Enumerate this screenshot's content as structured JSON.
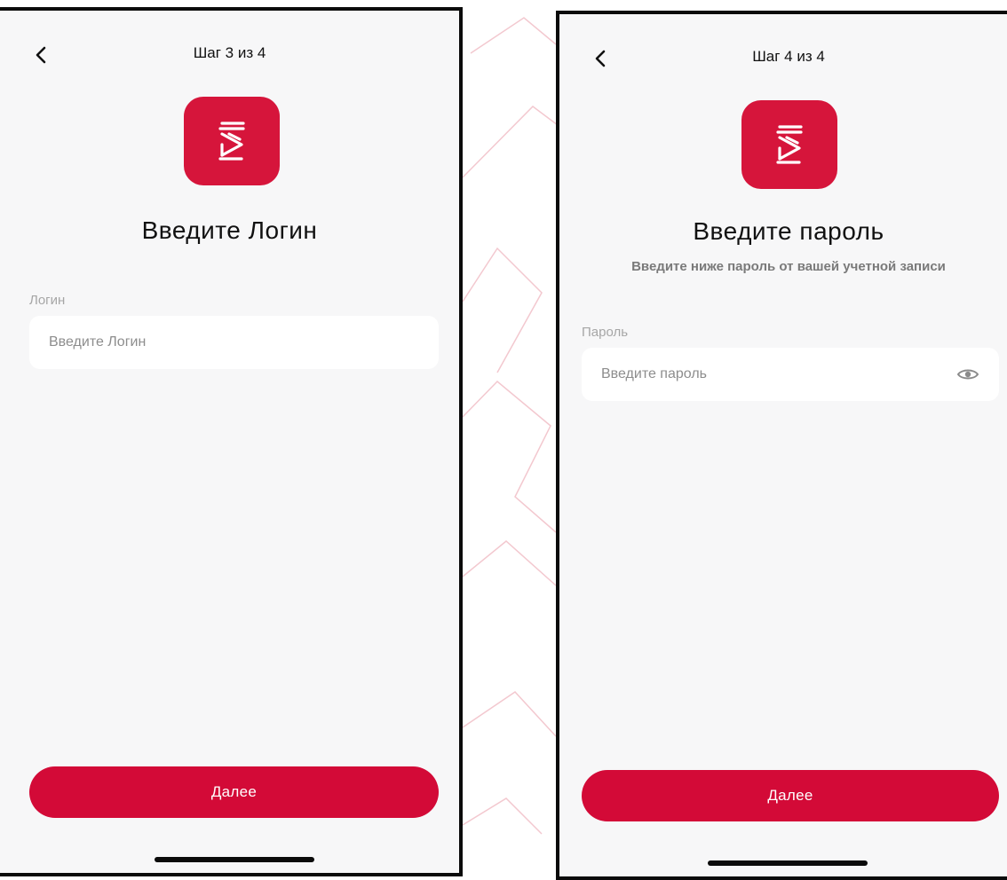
{
  "screens": [
    {
      "step_text": "Шаг 3 из 4",
      "title": "Введите Логин",
      "field_label": "Логин",
      "input_placeholder": "Введите Логин",
      "button_label": "Далее"
    },
    {
      "step_text": "Шаг 4 из 4",
      "title": "Введите пароль",
      "subtitle": "Введите ниже пароль от вашей учетной записи",
      "field_label": "Пароль",
      "input_placeholder": "Введите пароль",
      "button_label": "Далее"
    }
  ],
  "icons": {
    "back": "chevron-left-icon",
    "logo": "app-logo-icon",
    "visibility": "eye-icon"
  },
  "colors": {
    "brand_red": "#d30a37",
    "logo_red": "#d6153b",
    "screen_bg": "#f7f7f8",
    "input_bg": "#ffffff"
  }
}
